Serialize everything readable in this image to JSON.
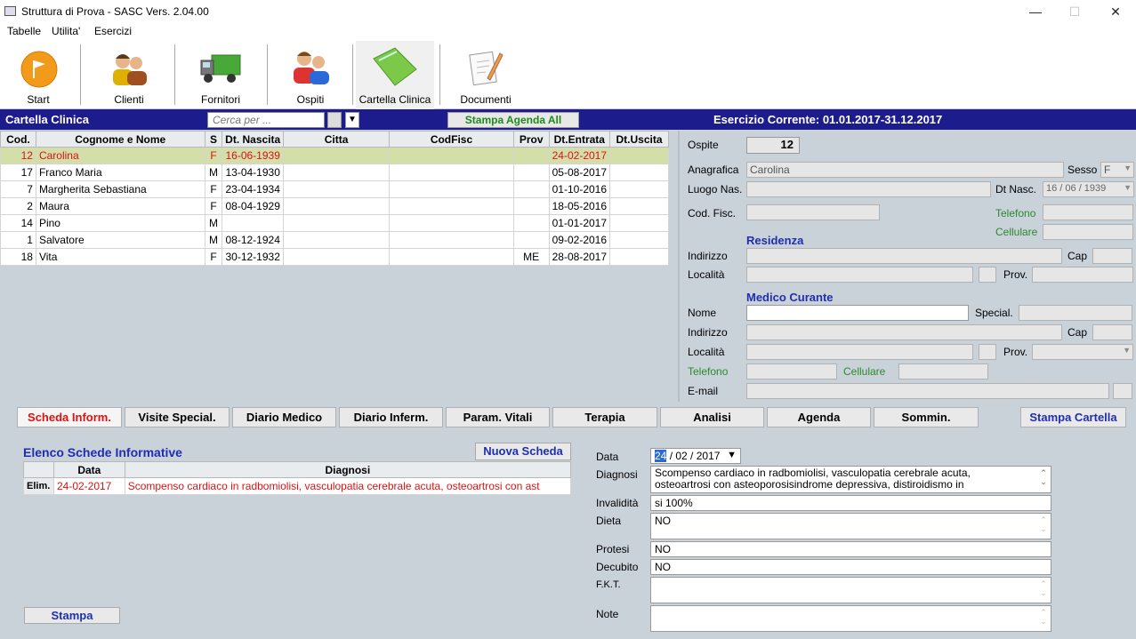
{
  "window": {
    "title": "Struttura di Prova - SASC Vers. 2.04.00",
    "minimize": "—",
    "maximize": "☐",
    "close": "✕"
  },
  "menu": [
    "Tabelle",
    "Utilita'",
    "Esercizi"
  ],
  "toolbar": [
    {
      "label": "Start",
      "icon": "start-flag-icon"
    },
    {
      "label": "Clienti",
      "icon": "clients-icon"
    },
    {
      "label": "Fornitori",
      "icon": "truck-icon"
    },
    {
      "label": "Ospiti",
      "icon": "guests-icon"
    },
    {
      "label": "Cartella Clinica",
      "icon": "green-folder-icon"
    },
    {
      "label": "Documenti",
      "icon": "document-pencil-icon"
    }
  ],
  "header": {
    "title": "Cartella Clinica",
    "search_placeholder": "Cerca per ...",
    "print_agenda": "Stampa Agenda All",
    "esercizio": "Esercizio Corrente: 01.01.2017-31.12.2017"
  },
  "grid": {
    "columns": [
      "Cod.",
      "Cognome e Nome",
      "S",
      "Dt. Nascita",
      "Citta",
      "CodFisc",
      "Prov",
      "Dt.Entrata",
      "Dt.Uscita"
    ],
    "rows": [
      [
        "12",
        "Carolina",
        "F",
        "16-06-1939",
        "",
        "",
        "",
        "24-02-2017",
        ""
      ],
      [
        "17",
        "Franco Maria",
        "M",
        "13-04-1930",
        "",
        "",
        "",
        "05-08-2017",
        ""
      ],
      [
        "7",
        "Margherita Sebastiana",
        "F",
        "23-04-1934",
        "",
        "",
        "",
        "01-10-2016",
        ""
      ],
      [
        "2",
        "Maura",
        "F",
        "08-04-1929",
        "",
        "",
        "",
        "18-05-2016",
        ""
      ],
      [
        "14",
        "Pino",
        "M",
        "",
        "",
        "",
        "",
        "01-01-2017",
        ""
      ],
      [
        "1",
        "Salvatore",
        "M",
        "08-12-1924",
        "",
        "",
        "",
        "09-02-2016",
        ""
      ],
      [
        "18",
        "Vita",
        "F",
        "30-12-1932",
        "",
        "",
        "ME",
        "28-08-2017",
        ""
      ]
    ]
  },
  "detail": {
    "ospite_label": "Ospite",
    "ospite_value": "12",
    "anagrafica_label": "Anagrafica",
    "anagrafica_value": "Carolina",
    "sesso_label": "Sesso",
    "sesso_value": "F",
    "luogo_label": "Luogo Nas.",
    "dtnasc_label": "Dt Nasc.",
    "dtnasc_value": "16 / 06 / 1939",
    "codfisc_label": "Cod. Fisc.",
    "telefono_label": "Telefono",
    "cellulare_label": "Cellulare",
    "residenza": "Residenza",
    "indirizzo_label": "Indirizzo",
    "cap_label": "Cap",
    "localita_label": "Località",
    "prov_label": "Prov.",
    "medico": "Medico Curante",
    "nome_label": "Nome",
    "special_label": "Special.",
    "email_label": "E-mail"
  },
  "tabs": [
    "Scheda Inform.",
    "Visite Special.",
    "Diario Medico",
    "Diario Inferm.",
    "Param. Vitali",
    "Terapia",
    "Analisi",
    "Agenda",
    "Sommin."
  ],
  "stampa_cartella": "Stampa Cartella",
  "schede": {
    "title": "Elenco Schede Informative",
    "new_button": "Nuova Scheda",
    "columns": [
      "",
      "Data",
      "Diagnosi"
    ],
    "rows": [
      [
        "Elim.",
        "24-02-2017",
        "Scompenso cardiaco in radbomiolisi, vasculopatia cerebrale acuta, osteoartrosi con ast"
      ]
    ],
    "stampa": "Stampa"
  },
  "form": {
    "data_label": "Data",
    "data_day": "24",
    "data_rest": "/ 02 / 2017",
    "diagnosi_label": "Diagnosi",
    "diagnosi_line1": "Scompenso cardiaco in radbomiolisi, vasculopatia cerebrale acuta,",
    "diagnosi_line2": "osteoartrosi con asteoporosisindrome depressiva, distiroidismo in",
    "invalidita_label": "Invalidità",
    "invalidita_value": "si 100%",
    "dieta_label": "Dieta",
    "dieta_value": "NO",
    "protesi_label": "Protesi",
    "protesi_value": "NO",
    "decubito_label": "Decubito",
    "decubito_value": "NO",
    "fkt_label": "F.K.T.",
    "note_label": "Note"
  }
}
